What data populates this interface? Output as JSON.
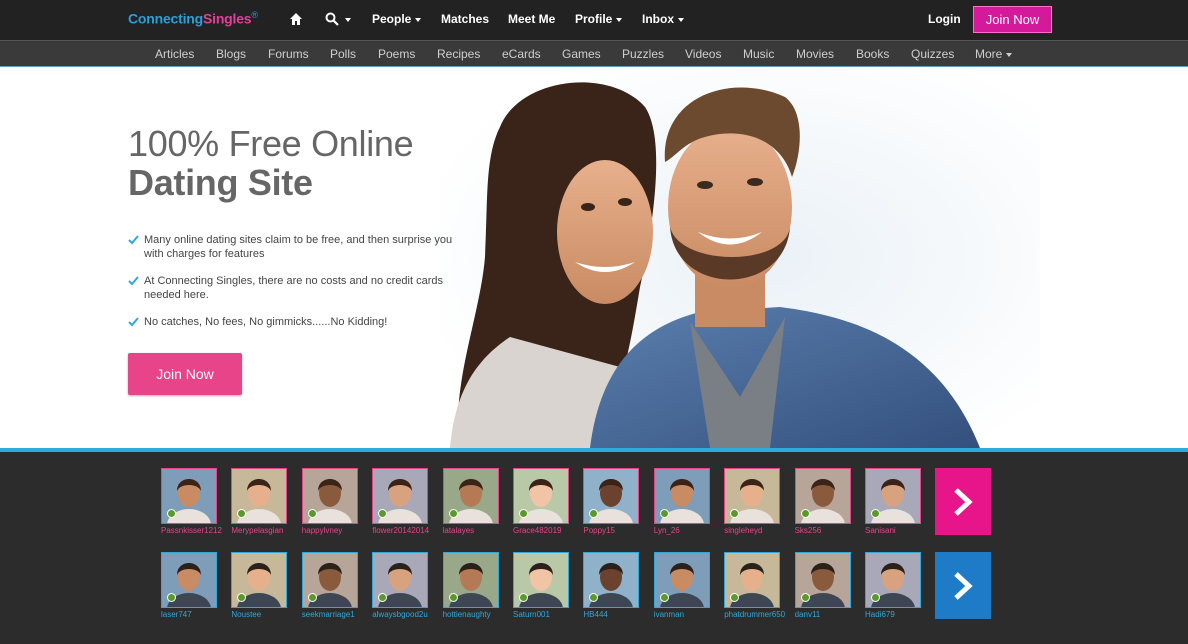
{
  "brand": {
    "part1": "Connecting",
    "part2": "Singles",
    "mark": "®"
  },
  "topnav": {
    "people": "People",
    "matches": "Matches",
    "meet_me": "Meet Me",
    "profile": "Profile",
    "inbox": "Inbox",
    "login": "Login",
    "join": "Join Now"
  },
  "subnav": [
    "Articles",
    "Blogs",
    "Forums",
    "Polls",
    "Poems",
    "Recipes",
    "eCards",
    "Games",
    "Puzzles",
    "Videos",
    "Music",
    "Movies",
    "Books",
    "Quizzes"
  ],
  "subnav_more": "More",
  "hero": {
    "title_line1": "100% Free Online",
    "title_line2": "Dating Site",
    "features": [
      "Many online dating sites claim to be free, and then surprise you with charges for features",
      "At Connecting Singles, there are no costs and no credit cards needed here.",
      "No catches, No fees, No gimmicks......No Kidding!"
    ],
    "join": "Join Now"
  },
  "members_female": [
    "Passnkisser1212",
    "Merypelasgian",
    "happylvney",
    "flower20142014",
    "latalayes",
    "Grace482019",
    "Poppy15",
    "Lyn_26",
    "singleheyd",
    "Sks256",
    "Sanisani"
  ],
  "members_male": [
    "laser747",
    "Noustee",
    "seekmarriage1",
    "alwaysbgood2u",
    "hottienaughty",
    "Saturn001",
    "HB444",
    "ivanman",
    "phatdrummer650",
    "danv11",
    "Hadi679"
  ],
  "colors": {
    "pink": "#e8448a",
    "blue": "#2fa8dc",
    "next_pink": "#e8148a",
    "next_blue": "#1e7bc8"
  }
}
